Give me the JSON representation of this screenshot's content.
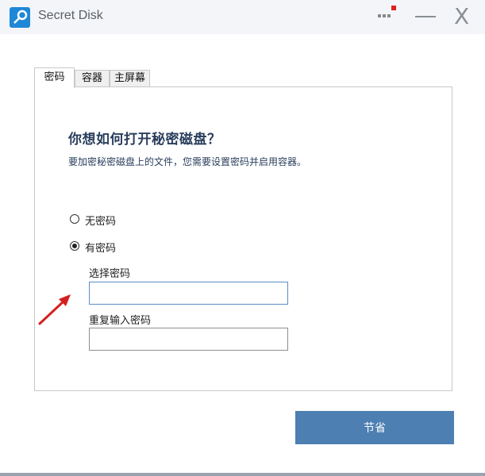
{
  "window": {
    "title": "Secret Disk",
    "close_glyph": "X"
  },
  "tabs": [
    {
      "label": "密码",
      "active": true
    },
    {
      "label": "容器",
      "active": false
    },
    {
      "label": "主屏幕",
      "active": false
    }
  ],
  "main": {
    "heading": "你想如何打开秘密磁盘？",
    "subtext": "要加密秘密磁盘上的文件，您需要设置密码并启用容器。",
    "options": [
      {
        "label": "无密码",
        "selected": false
      },
      {
        "label": "有密码",
        "selected": true
      }
    ],
    "choose_password": {
      "label": "选择密码",
      "value": ""
    },
    "repeat_password": {
      "label": "重复输入密码",
      "value": ""
    }
  },
  "actions": {
    "save_label": "节省"
  },
  "colors": {
    "accent": "#4d7fb2",
    "heading": "#2a3e5c",
    "arrow": "#d42020",
    "icon": "#1e88d6"
  },
  "icons": [
    "app-key-icon",
    "menu-icon",
    "minimize-icon",
    "close-icon",
    "annotation-arrow-icon"
  ]
}
